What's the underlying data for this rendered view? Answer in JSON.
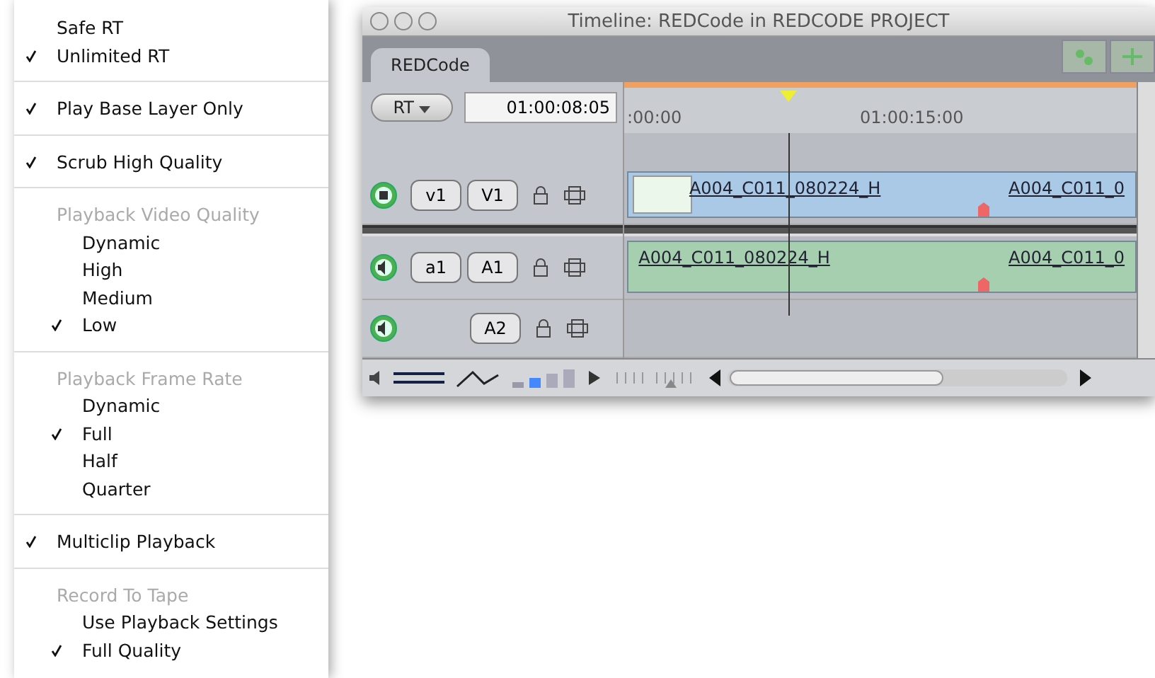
{
  "menu": {
    "groups": [
      {
        "items": [
          {
            "label": "Safe RT",
            "checked": false
          },
          {
            "label": "Unlimited RT",
            "checked": true
          }
        ]
      },
      {
        "items": [
          {
            "label": "Play Base Layer Only",
            "checked": true
          }
        ]
      },
      {
        "items": [
          {
            "label": "Scrub High Quality",
            "checked": true
          }
        ]
      },
      {
        "header": "Playback Video Quality",
        "items": [
          {
            "label": "Dynamic",
            "checked": false
          },
          {
            "label": "High",
            "checked": false
          },
          {
            "label": "Medium",
            "checked": false
          },
          {
            "label": "Low",
            "checked": true
          }
        ]
      },
      {
        "header": "Playback Frame Rate",
        "items": [
          {
            "label": "Dynamic",
            "checked": false
          },
          {
            "label": "Full",
            "checked": true
          },
          {
            "label": "Half",
            "checked": false
          },
          {
            "label": "Quarter",
            "checked": false
          }
        ]
      },
      {
        "items": [
          {
            "label": "Multiclip Playback",
            "checked": true
          }
        ]
      },
      {
        "header": "Record To Tape",
        "items": [
          {
            "label": "Use Playback Settings",
            "checked": false
          },
          {
            "label": "Full Quality",
            "checked": true
          }
        ]
      }
    ]
  },
  "window": {
    "title": "Timeline: REDCode in REDCODE PROJECT",
    "tab": "REDCode",
    "rt_button": "RT",
    "timecode": "01:00:08:05",
    "ruler_labels": [
      ":00:00",
      "01:00:15:00"
    ],
    "tracks": [
      {
        "kind": "video",
        "source": "v1",
        "dest": "V1",
        "clips": [
          "A004_C011_080224_H",
          "A004_C011_0"
        ]
      },
      {
        "kind": "audio",
        "source": "a1",
        "dest": "A1",
        "clips": [
          "A004_C011_080224_H",
          "A004_C011_0"
        ]
      },
      {
        "kind": "audio",
        "dest": "A2"
      }
    ]
  }
}
